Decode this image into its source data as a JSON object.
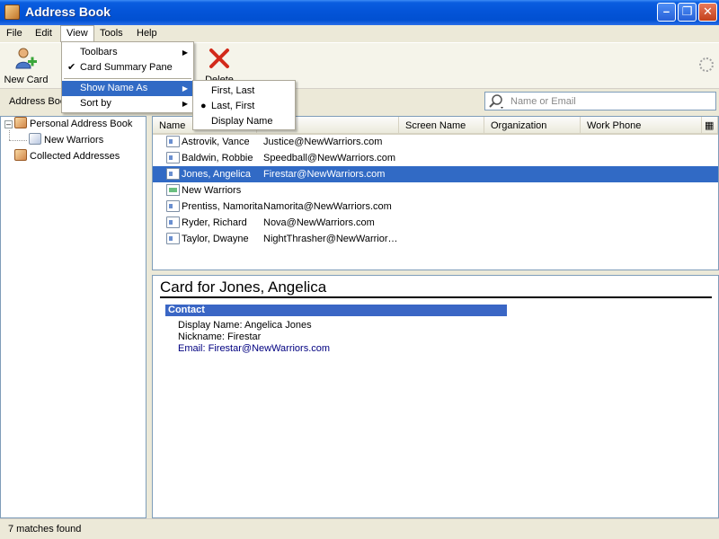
{
  "window": {
    "title": "Address Book"
  },
  "menubar": {
    "file": "File",
    "edit": "Edit",
    "view": "View",
    "tools": "Tools",
    "help": "Help"
  },
  "toolbar": {
    "new_card": "New Card",
    "delete": "Delete"
  },
  "search": {
    "label": "Address Book",
    "placeholder": "Name or Email",
    "value": ""
  },
  "view_menu": {
    "toolbars": "Toolbars",
    "card_summary_pane": "Card Summary Pane",
    "card_summary_checked": true,
    "show_name_as": "Show Name As",
    "sort_by": "Sort by"
  },
  "show_name_submenu": {
    "first_last": "First, Last",
    "last_first": "Last, First",
    "display_name": "Display Name",
    "selected": "last_first"
  },
  "directories": [
    {
      "label": "Personal Address Book",
      "level": 0,
      "expanded": true
    },
    {
      "label": "New Warriors",
      "level": 1
    },
    {
      "label": "Collected Addresses",
      "level": 0
    }
  ],
  "columns": [
    "Name",
    "",
    "Screen Name",
    "Organization",
    "Work Phone"
  ],
  "rows": [
    {
      "name": "Astrovik, Vance",
      "email": "Justice@NewWarriors.com",
      "type": "card"
    },
    {
      "name": "Baldwin, Robbie",
      "email": "Speedball@NewWarriors.com",
      "type": "card"
    },
    {
      "name": "Jones, Angelica",
      "email": "Firestar@NewWarriors.com",
      "type": "card",
      "selected": true
    },
    {
      "name": "New Warriors",
      "email": "",
      "type": "list"
    },
    {
      "name": "Prentiss, Namorita",
      "email": "Namorita@NewWarriors.com",
      "type": "card"
    },
    {
      "name": "Ryder, Richard",
      "email": "Nova@NewWarriors.com",
      "type": "card"
    },
    {
      "name": "Taylor, Dwayne",
      "email": "NightThrasher@NewWarrior…",
      "type": "card"
    }
  ],
  "card": {
    "title": "Card for Jones, Angelica",
    "section": "Contact",
    "display_name": "Display Name: Angelica Jones",
    "nickname": "Nickname: Firestar",
    "email": "Email: Firestar@NewWarriors.com"
  },
  "status": {
    "text": "7 matches found"
  },
  "colors": {
    "selection": "#316ac5",
    "section_heading": "#3a66c5",
    "link": "#000080"
  }
}
